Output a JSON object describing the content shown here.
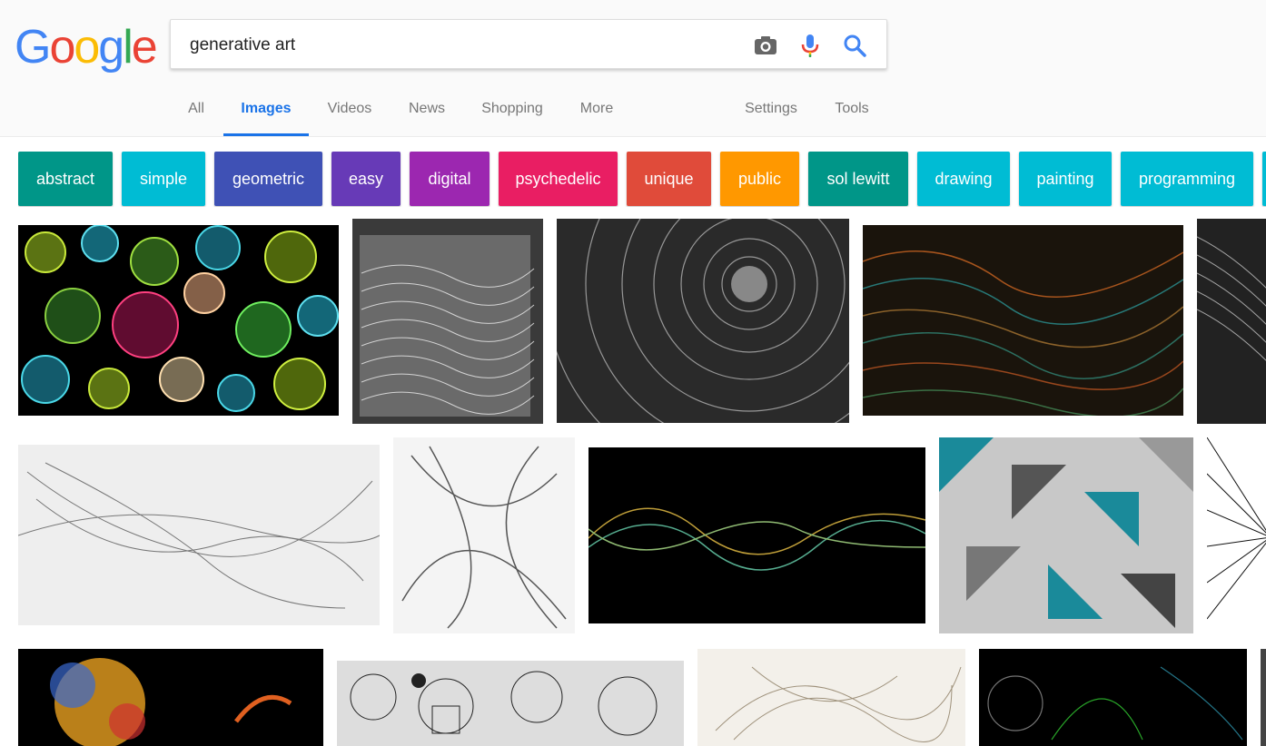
{
  "logo": {
    "text": "Google"
  },
  "search": {
    "query": "generative art"
  },
  "tabs": {
    "all": "All",
    "images": "Images",
    "videos": "Videos",
    "news": "News",
    "shopping": "Shopping",
    "more": "More",
    "settings": "Settings",
    "tools": "Tools"
  },
  "chips": [
    {
      "label": "abstract",
      "color": "#009688"
    },
    {
      "label": "simple",
      "color": "#00bcd4"
    },
    {
      "label": "geometric",
      "color": "#3f51b5"
    },
    {
      "label": "easy",
      "color": "#673ab7"
    },
    {
      "label": "digital",
      "color": "#9c27b0"
    },
    {
      "label": "psychedelic",
      "color": "#e91e63"
    },
    {
      "label": "unique",
      "color": "#e04b3a"
    },
    {
      "label": "public",
      "color": "#ff9800"
    },
    {
      "label": "sol lewitt",
      "color": "#009688"
    },
    {
      "label": "drawing",
      "color": "#00bcd4"
    },
    {
      "label": "painting",
      "color": "#00bcd4"
    },
    {
      "label": "programming",
      "color": "#00bcd4"
    }
  ],
  "colors": {
    "accent": "#1a73e8",
    "tab_text": "#777777"
  }
}
